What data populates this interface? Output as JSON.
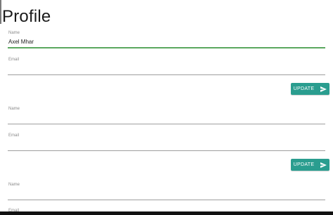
{
  "page": {
    "title": "Profile"
  },
  "forms": [
    {
      "name_label": "Name",
      "name_value": "Axel Mhar",
      "email_label": "Email",
      "email_value": "",
      "update_label": "UPDATE"
    },
    {
      "name_label": "Name",
      "name_value": "",
      "email_label": "Email",
      "email_value": "",
      "update_label": "UPDATE"
    },
    {
      "name_label": "Name",
      "name_value": "",
      "email_label": "Email",
      "email_value": ""
    }
  ],
  "colors": {
    "accent": "#2a9d8f",
    "focus_underline": "#5aa85f"
  },
  "icons": {
    "update_button_icon": "send-icon"
  }
}
